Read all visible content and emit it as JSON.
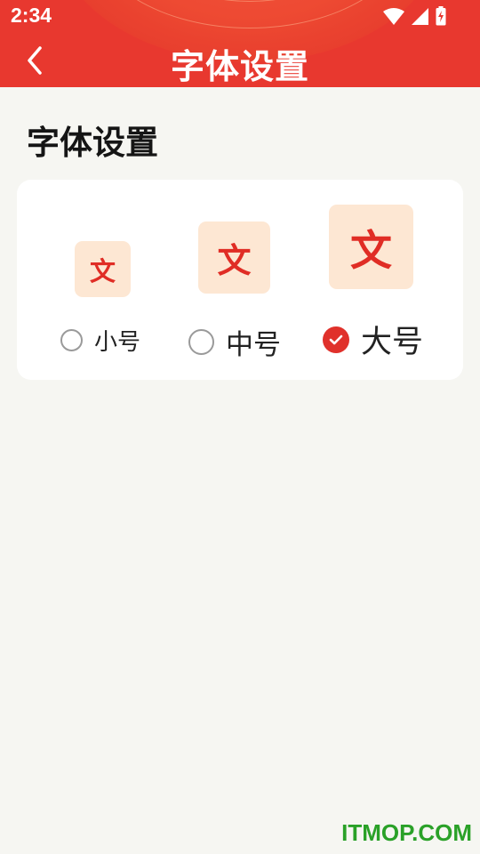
{
  "status_bar": {
    "time": "2:34"
  },
  "header": {
    "title": "字体设置"
  },
  "section": {
    "title": "字体设置"
  },
  "font_options": [
    {
      "glyph": "文",
      "label": "小号",
      "selected": false
    },
    {
      "glyph": "文",
      "label": "中号",
      "selected": false
    },
    {
      "glyph": "文",
      "label": "大号",
      "selected": true
    }
  ],
  "watermark": "ITMOP.COM",
  "colors": {
    "accent": "#e8382f",
    "glyph_bg": "#fde7d3",
    "glyph": "#e02d25",
    "watermark": "#2aa128"
  }
}
